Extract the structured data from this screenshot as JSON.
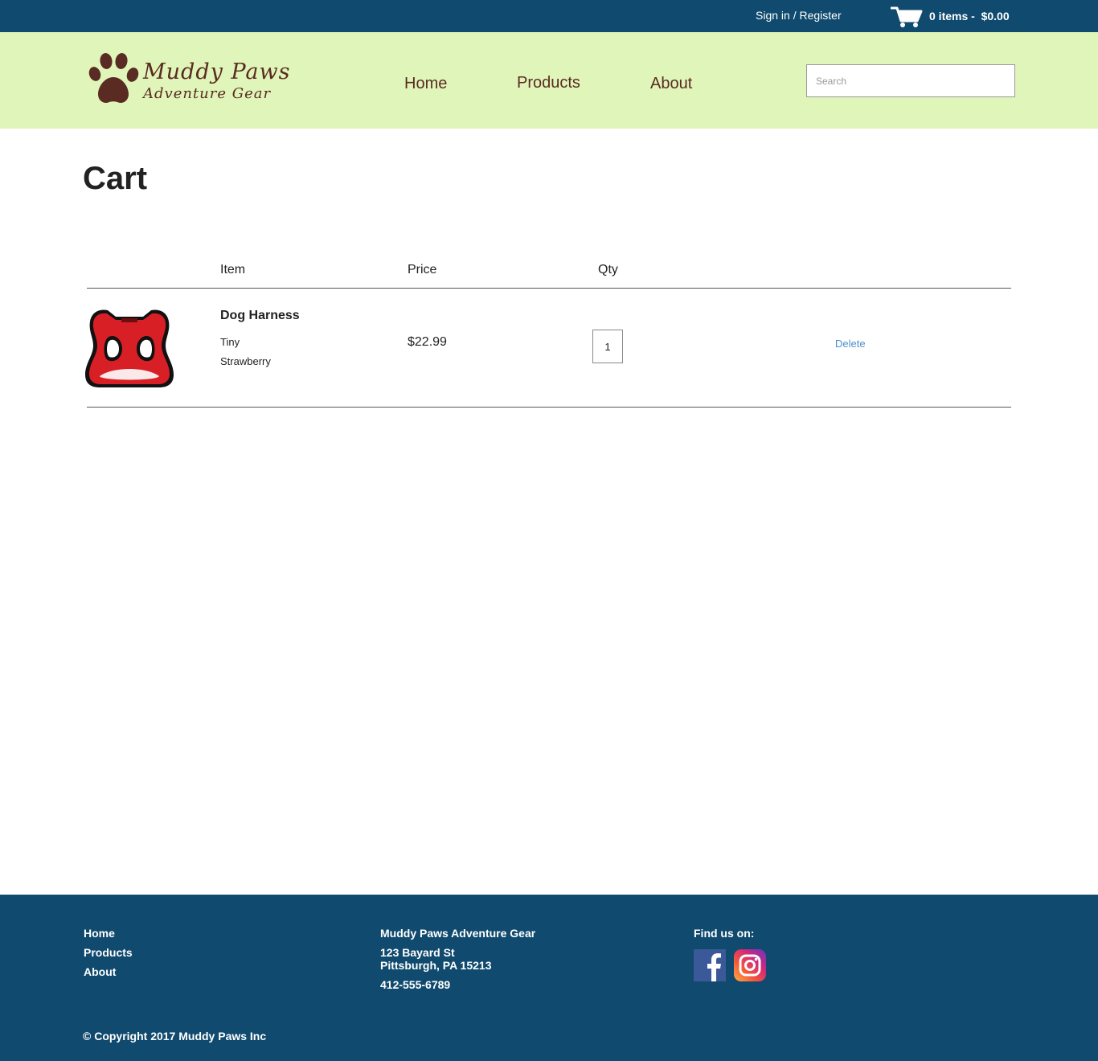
{
  "topbar": {
    "signin_label": "Sign in / Register",
    "cart_summary": "0 items -  $0.00",
    "background_color": "#104a6e"
  },
  "header": {
    "logo_line1": "Muddy Paws",
    "logo_line2": "Adventure Gear",
    "nav": {
      "home": "Home",
      "products": "Products",
      "about": "About"
    },
    "search_placeholder": "Search",
    "background_color": "#e0f5b9"
  },
  "cart": {
    "title": "Cart",
    "columns": {
      "item": "Item",
      "price": "Price",
      "qty": "Qty"
    },
    "items": [
      {
        "name": "Dog Harness",
        "size": "Tiny",
        "color": "Strawberry",
        "price": "$22.99",
        "qty": "1",
        "delete_label": "Delete"
      }
    ]
  },
  "footer": {
    "links": {
      "home": "Home",
      "products": "Products",
      "about": "About"
    },
    "company": "Muddy Paws Adventure Gear",
    "street": "123 Bayard St",
    "city": "Pittsburgh, PA 15213",
    "phone": "412-555-6789",
    "find_us": "Find us on:",
    "social": [
      "facebook-icon",
      "instagram-icon"
    ],
    "copyright": "© Copyright 2017 Muddy Paws Inc"
  }
}
